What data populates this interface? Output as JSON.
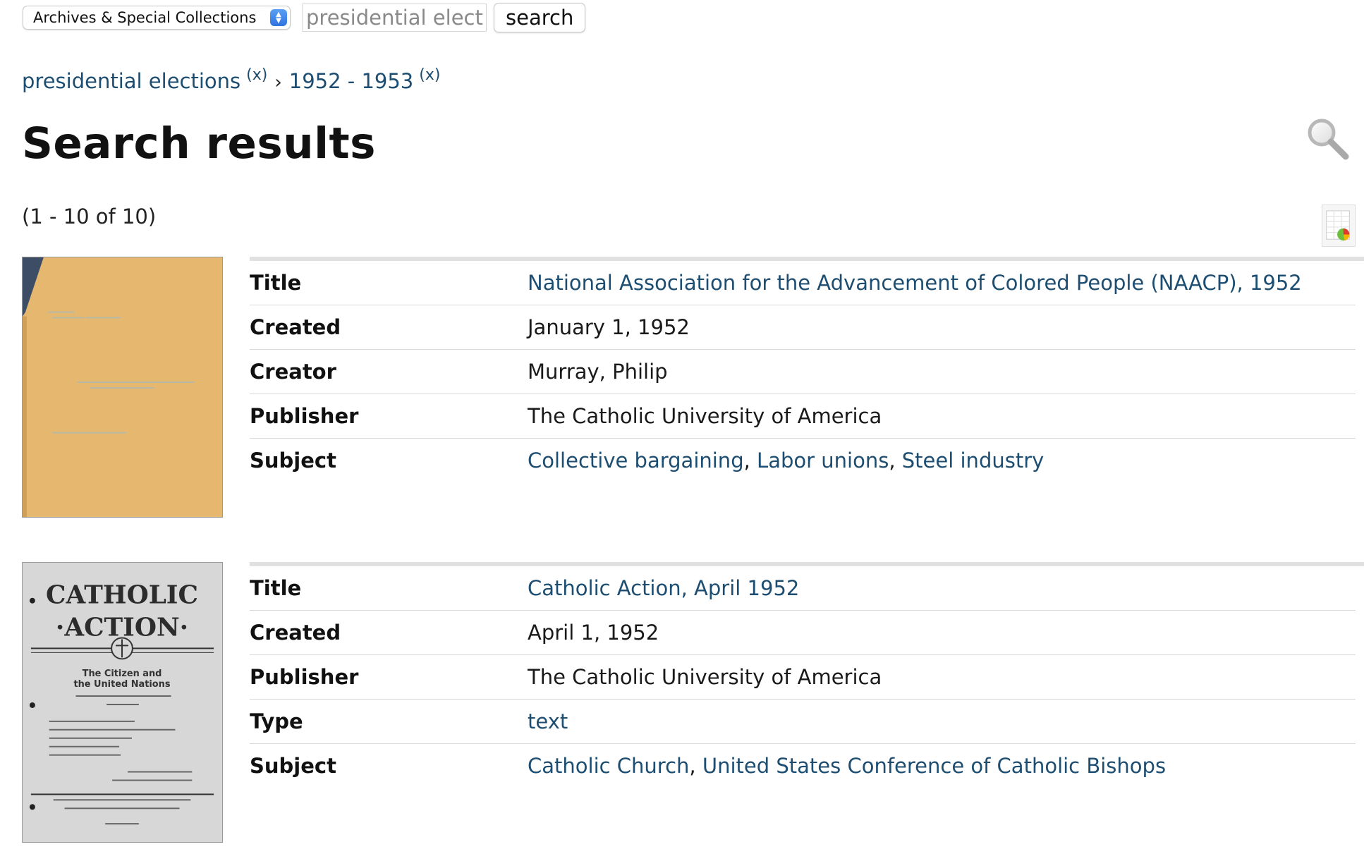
{
  "search": {
    "collection": "Archives & Special Collections",
    "query": "presidential elections",
    "button_label": "search"
  },
  "breadcrumb": [
    {
      "label": "presidential elections",
      "remove": "(x)"
    },
    {
      "label": "1952 - 1953",
      "remove": "(x)"
    }
  ],
  "breadcrumb_separator": "›",
  "page_title": "Search results",
  "result_count": "(1 - 10 of 10)",
  "results": [
    {
      "thumbnail": "tan-typescript-page",
      "fields": [
        {
          "label": "Title",
          "value": "National Association for the Advancement of Colored People (NAACP), 1952"
        },
        {
          "label": "Created",
          "value": "January 1, 1952"
        },
        {
          "label": "Creator",
          "value": "Murray, Philip"
        },
        {
          "label": "Publisher",
          "value": "The Catholic University of America"
        },
        {
          "label": "Subject",
          "links": [
            "Collective bargaining",
            "Labor unions",
            "Steel industry"
          ]
        }
      ]
    },
    {
      "thumbnail": "catholic-action-cover",
      "cover": {
        "masthead_1": "CATHOLIC",
        "masthead_2": "·ACTION·",
        "headline_1": "The Citizen and",
        "headline_2": "the United Nations"
      },
      "fields": [
        {
          "label": "Title",
          "value": "Catholic Action, April 1952"
        },
        {
          "label": "Created",
          "value": "April 1, 1952"
        },
        {
          "label": "Publisher",
          "value": "The Catholic University of America"
        },
        {
          "label": "Type",
          "value": "text"
        },
        {
          "label": "Subject",
          "links": [
            "Catholic Church",
            "United States Conference of Catholic Bishops"
          ]
        }
      ]
    }
  ],
  "colors": {
    "link": "#1d4e72",
    "thumb_paper": "#e6b86f",
    "rule": "#e1e1e1"
  },
  "icons": [
    "select-arrows-icon",
    "magnifier-icon",
    "export-chart-icon"
  ]
}
